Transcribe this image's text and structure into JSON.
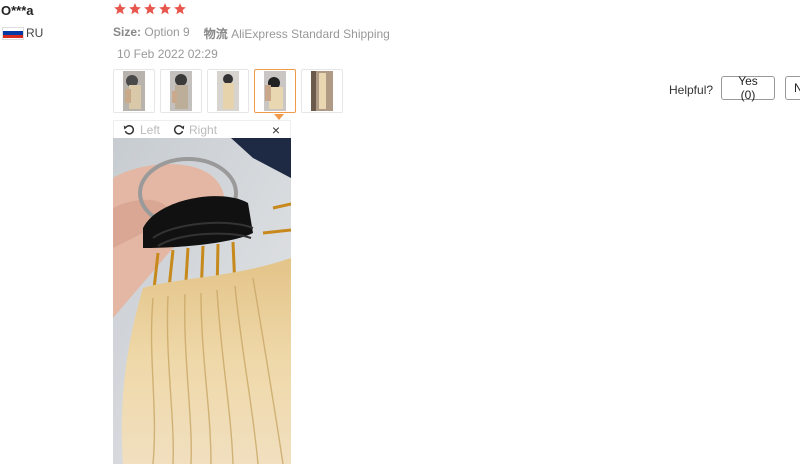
{
  "review": {
    "user_name": "O***a",
    "country": "RU",
    "rating": 5,
    "size_label": "Size:",
    "size_value": "Option 9",
    "shipping_label": "物流",
    "shipping_value": "AliExpress Standard Shipping",
    "date": "10 Feb 2022 02:29"
  },
  "thumbnails": [
    {
      "name": "photo-1",
      "selected": false
    },
    {
      "name": "photo-2",
      "selected": false
    },
    {
      "name": "photo-3",
      "selected": false
    },
    {
      "name": "photo-4",
      "selected": true
    },
    {
      "name": "photo-5",
      "selected": false
    }
  ],
  "viewer": {
    "rotate_left": "Left",
    "rotate_right": "Right",
    "close_symbol": "×"
  },
  "helpful": {
    "label": "Helpful?",
    "yes_label": "Yes (0)",
    "no_label": "N"
  },
  "colors": {
    "star": "#e8574d",
    "accent": "#f09a4a"
  }
}
